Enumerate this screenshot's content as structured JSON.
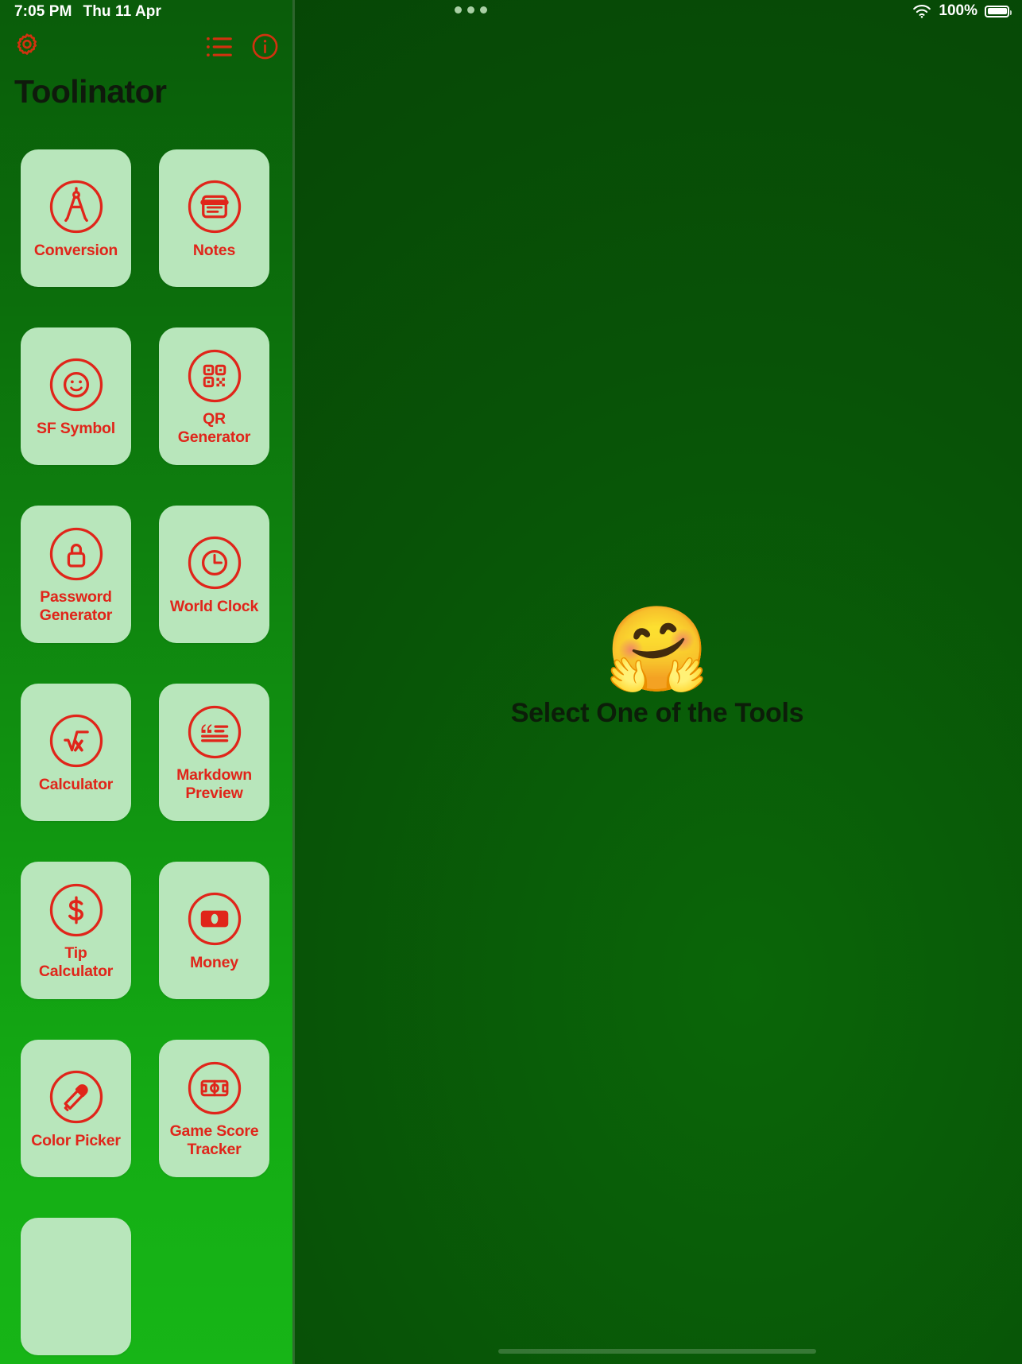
{
  "statusbar": {
    "time": "7:05 PM",
    "date": "Thu 11 Apr",
    "battery_percent": "100%",
    "wifi_icon": "wifi-icon",
    "battery_icon": "battery-full-icon",
    "multitask_handle_icon": "three-dots-icon"
  },
  "sidebar": {
    "title": "Toolinator",
    "toolbar": {
      "settings_icon": "gear-icon",
      "list_icon": "list-bullet-icon",
      "info_icon": "info-circle-icon"
    },
    "tools": [
      {
        "label": "Conversion",
        "icon": "compass-drafting-icon"
      },
      {
        "label": "Notes",
        "icon": "note-text-icon"
      },
      {
        "label": "SF Symbol",
        "icon": "smiley-face-icon"
      },
      {
        "label": "QR\nGenerator",
        "icon": "qr-code-icon"
      },
      {
        "label": "Password\nGenerator",
        "icon": "lock-icon"
      },
      {
        "label": "World Clock",
        "icon": "clock-icon"
      },
      {
        "label": "Calculator",
        "icon": "square-root-icon"
      },
      {
        "label": "Markdown\nPreview",
        "icon": "quote-lines-icon"
      },
      {
        "label": "Tip\nCalculator",
        "icon": "dollar-sign-icon"
      },
      {
        "label": "Money",
        "icon": "banknote-icon"
      },
      {
        "label": "Color Picker",
        "icon": "eyedropper-icon"
      },
      {
        "label": "Game Score\nTracker",
        "icon": "sports-field-icon"
      },
      {
        "label": "",
        "icon": ""
      }
    ]
  },
  "detail": {
    "empty_emoji": "🤗",
    "empty_text": "Select One of the Tools"
  },
  "colors": {
    "accent_red": "#e0251a",
    "toolbar_red": "#d1320f",
    "card_bg": "#b8e6bb",
    "sidebar_green_top": "#0a5c0a",
    "sidebar_green_bottom": "#17b517",
    "detail_green": "#085207",
    "title_dark": "#0f1a0c"
  }
}
